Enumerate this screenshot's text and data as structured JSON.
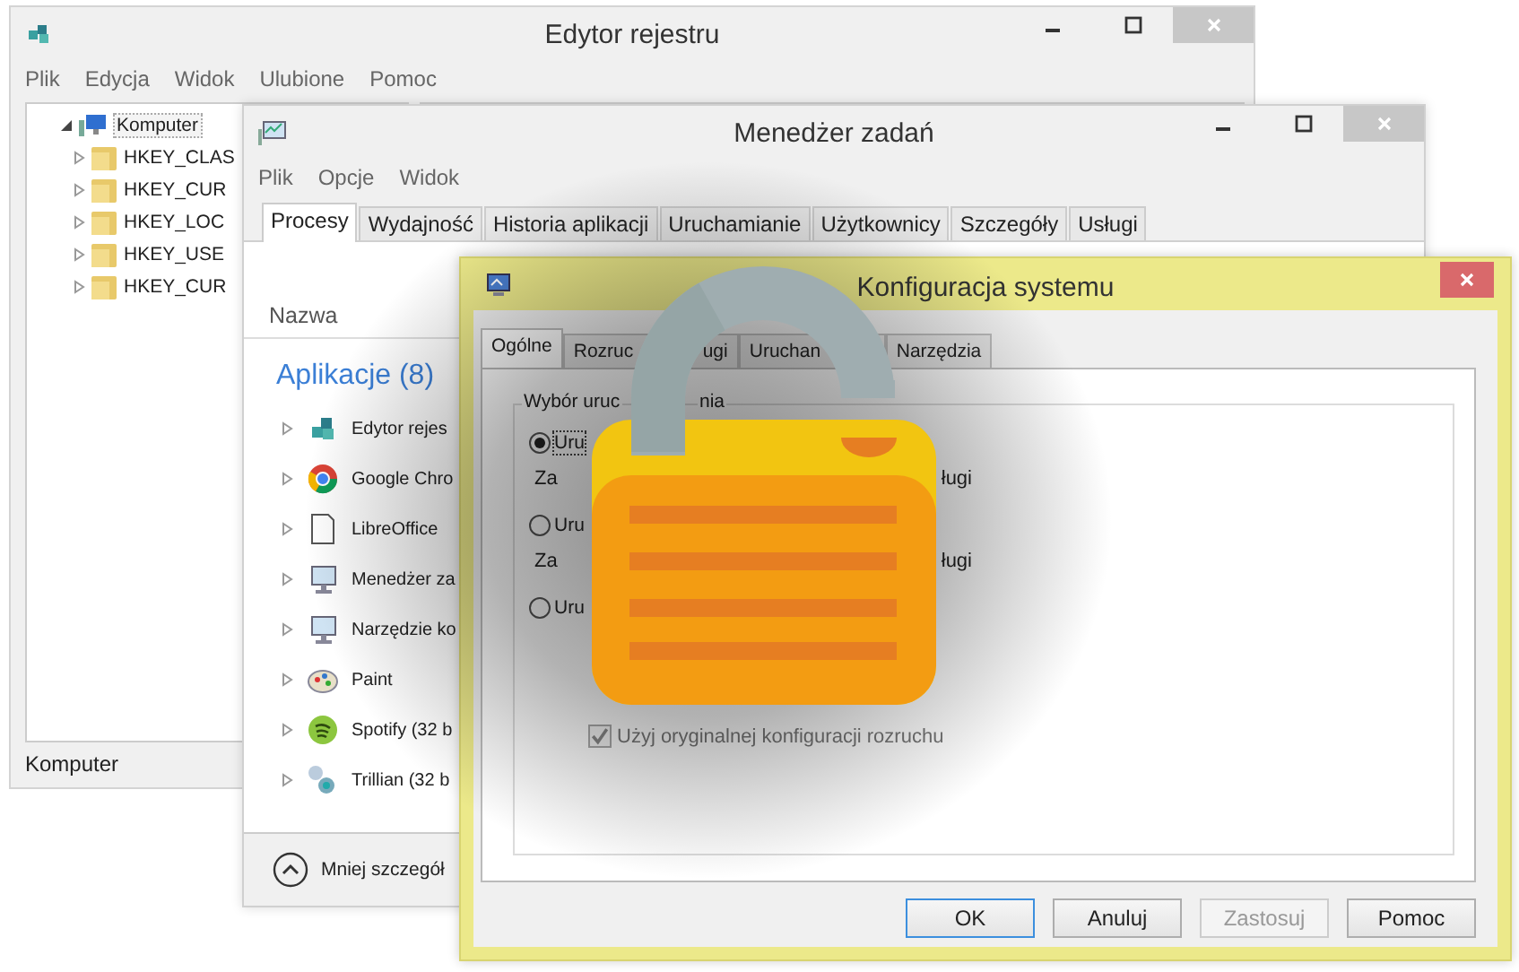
{
  "registry_editor": {
    "title": "Edytor rejestru",
    "menu": [
      "Plik",
      "Edycja",
      "Widok",
      "Ulubione",
      "Pomoc"
    ],
    "tree": {
      "label": "Komputer",
      "expanded": true,
      "selected": true,
      "children": [
        {
          "label": "HKEY_CLAS",
          "expanded": false,
          "selected": false
        },
        {
          "label": "HKEY_CUR",
          "expanded": false,
          "selected": false
        },
        {
          "label": "HKEY_LOC",
          "expanded": false,
          "selected": false
        },
        {
          "label": "HKEY_USE",
          "expanded": false,
          "selected": false
        },
        {
          "label": "HKEY_CUR",
          "expanded": false,
          "selected": false
        }
      ]
    },
    "status_bar": "Komputer"
  },
  "task_manager": {
    "title": "Menedżer zadań",
    "menu": [
      "Plik",
      "Opcje",
      "Widok"
    ],
    "tabs": [
      {
        "label": "Procesy",
        "selected": true
      },
      {
        "label": "Wydajność",
        "selected": false
      },
      {
        "label": "Historia aplikacji",
        "selected": false
      },
      {
        "label": "Uruchamianie",
        "selected": false
      },
      {
        "label": "Użytkownicy",
        "selected": false
      },
      {
        "label": "Szczegóły",
        "selected": false
      },
      {
        "label": "Usługi",
        "selected": false
      }
    ],
    "column_header": "Nazwa",
    "group": {
      "label": "Aplikacje (8)",
      "items": [
        {
          "label": "Edytor rejes",
          "expanded": false
        },
        {
          "label": "Google Chro",
          "expanded": false
        },
        {
          "label": "LibreOffice",
          "expanded": false
        },
        {
          "label": "Menedżer za",
          "expanded": false
        },
        {
          "label": "Narzędzie ko",
          "expanded": false
        },
        {
          "label": "Paint",
          "expanded": false
        },
        {
          "label": "Spotify (32 b",
          "expanded": false
        },
        {
          "label": "Trillian (32 b",
          "expanded": false
        }
      ]
    },
    "footer_link": "Mniej szczegół"
  },
  "system_configuration": {
    "title": "Konfiguracja systemu",
    "tabs": [
      {
        "parts": [
          "Ogólne"
        ],
        "selected": true
      },
      {
        "parts": [
          "Rozruc",
          "ugi"
        ],
        "selected": false
      },
      {
        "parts": [
          "Uruchan"
        ],
        "selected": false
      },
      {
        "parts": [
          "Narzędzia"
        ],
        "selected": false
      }
    ],
    "group_title_parts": [
      "Wybór uruc",
      "nia"
    ],
    "options": [
      {
        "label": "Uru",
        "selected": true,
        "description_parts": [
          "Za",
          "ługi"
        ]
      },
      {
        "label": "Uru",
        "selected": false,
        "description_parts": [
          "Za",
          "ługi"
        ]
      },
      {
        "label": "Uru",
        "selected": false
      }
    ],
    "checkbox": {
      "label": "Użyj oryginalnej konfiguracji rozruchu",
      "checked": true,
      "disabled": true
    },
    "buttons": [
      {
        "label": "OK",
        "default": true,
        "disabled": false
      },
      {
        "label": "Anuluj",
        "default": false,
        "disabled": false
      },
      {
        "label": "Zastosuj",
        "default": false,
        "disabled": true
      },
      {
        "label": "Pomoc",
        "default": false,
        "disabled": false
      }
    ]
  }
}
